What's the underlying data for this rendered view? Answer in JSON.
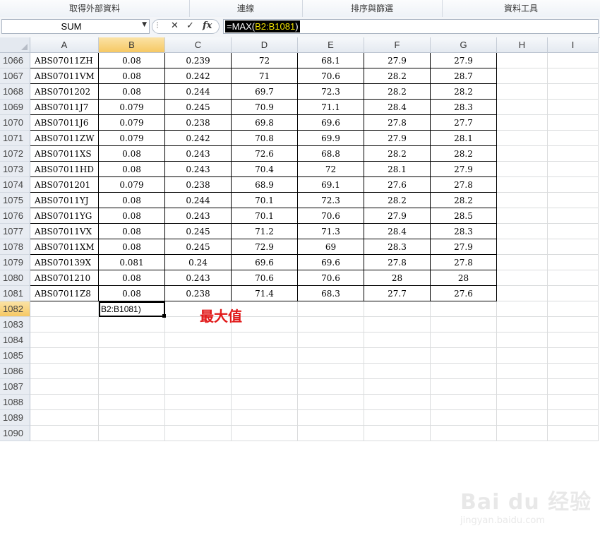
{
  "ribbon": {
    "groups": [
      "取得外部資料",
      "連線",
      "排序與篩選",
      "資料工具"
    ]
  },
  "formula_bar": {
    "name_box": "SUM",
    "cancel_glyph": "✕",
    "enter_glyph": "✓",
    "fx_label": "fx",
    "formula": {
      "prefix": "=MAX(",
      "range": "B2:B1081",
      "suffix": ")"
    }
  },
  "grid": {
    "columns": [
      "A",
      "B",
      "C",
      "D",
      "E",
      "F",
      "G",
      "H",
      "I"
    ],
    "selected_column": "B",
    "rows": [
      {
        "n": "1066",
        "cells": [
          "ABS07011ZH",
          "0.08",
          "0.239",
          "72",
          "68.1",
          "27.9",
          "27.9"
        ]
      },
      {
        "n": "1067",
        "cells": [
          "ABS07011VM",
          "0.08",
          "0.242",
          "71",
          "70.6",
          "28.2",
          "28.7"
        ]
      },
      {
        "n": "1068",
        "cells": [
          "ABS0701202",
          "0.08",
          "0.244",
          "69.7",
          "72.3",
          "28.2",
          "28.2"
        ]
      },
      {
        "n": "1069",
        "cells": [
          "ABS07011J7",
          "0.079",
          "0.245",
          "70.9",
          "71.1",
          "28.4",
          "28.3"
        ]
      },
      {
        "n": "1070",
        "cells": [
          "ABS07011J6",
          "0.079",
          "0.238",
          "69.8",
          "69.6",
          "27.8",
          "27.7"
        ]
      },
      {
        "n": "1071",
        "cells": [
          "ABS07011ZW",
          "0.079",
          "0.242",
          "70.8",
          "69.9",
          "27.9",
          "28.1"
        ]
      },
      {
        "n": "1072",
        "cells": [
          "ABS07011XS",
          "0.08",
          "0.243",
          "72.6",
          "68.8",
          "28.2",
          "28.2"
        ]
      },
      {
        "n": "1073",
        "cells": [
          "ABS07011HD",
          "0.08",
          "0.243",
          "70.4",
          "72",
          "28.1",
          "27.9"
        ]
      },
      {
        "n": "1074",
        "cells": [
          "ABS0701201",
          "0.079",
          "0.238",
          "68.9",
          "69.1",
          "27.6",
          "27.8"
        ]
      },
      {
        "n": "1075",
        "cells": [
          "ABS07011YJ",
          "0.08",
          "0.244",
          "70.1",
          "72.3",
          "28.2",
          "28.2"
        ]
      },
      {
        "n": "1076",
        "cells": [
          "ABS07011YG",
          "0.08",
          "0.243",
          "70.1",
          "70.6",
          "27.9",
          "28.5"
        ]
      },
      {
        "n": "1077",
        "cells": [
          "ABS07011VX",
          "0.08",
          "0.245",
          "71.2",
          "71.3",
          "28.4",
          "28.3"
        ]
      },
      {
        "n": "1078",
        "cells": [
          "ABS07011XM",
          "0.08",
          "0.245",
          "72.9",
          "69",
          "28.3",
          "27.9"
        ]
      },
      {
        "n": "1079",
        "cells": [
          "ABS070139X",
          "0.081",
          "0.24",
          "69.6",
          "69.6",
          "27.8",
          "27.8"
        ]
      },
      {
        "n": "1080",
        "cells": [
          "ABS0701210",
          "0.08",
          "0.243",
          "70.6",
          "70.6",
          "28",
          "28"
        ]
      },
      {
        "n": "1081",
        "cells": [
          "ABS07011Z8",
          "0.08",
          "0.238",
          "71.4",
          "68.3",
          "27.7",
          "27.6"
        ]
      }
    ],
    "empty_rows": [
      "1082",
      "1083",
      "1084",
      "1085",
      "1086",
      "1087",
      "1088",
      "1089",
      "1090"
    ],
    "active_row": "1082",
    "active_cell_text": "B2:B1081)"
  },
  "annotation": {
    "text": "最大值",
    "color": "#e11818"
  },
  "watermark": {
    "main": "Bai du 经验",
    "sub": "jingyan.baidu.com"
  },
  "colors": {
    "selected_header": "#f6c863",
    "formula_highlight_bg": "#000000",
    "formula_range": "#f0e000"
  }
}
